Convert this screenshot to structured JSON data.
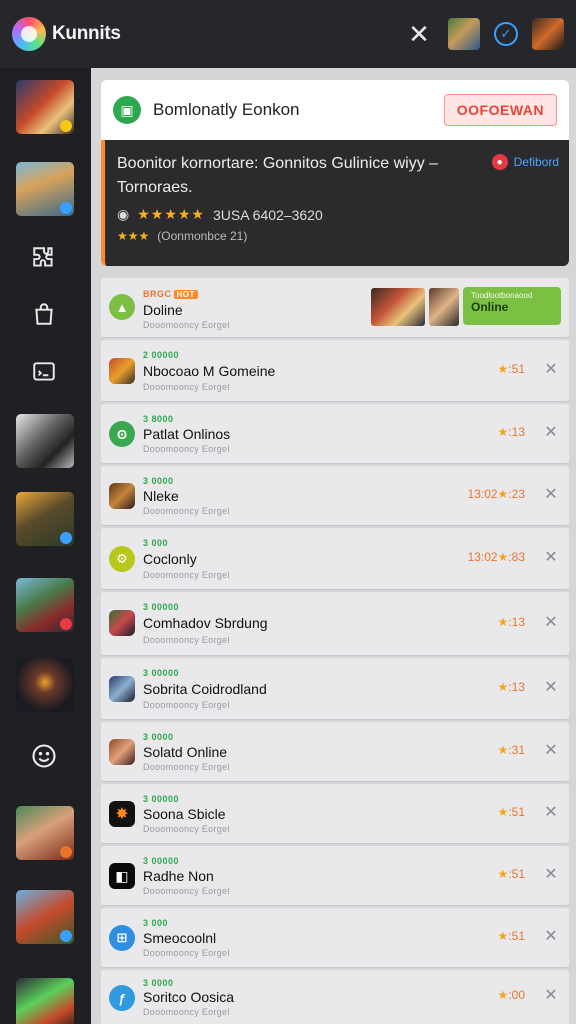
{
  "app": {
    "title": "Kunnits"
  },
  "banner": {
    "title": "Bomlonatly Eonkon",
    "button": "OOFOEWAN"
  },
  "promo": {
    "title": "Boonitor kornortare: Gonnitos Gulinice wiyy – Tornoraes.",
    "tag": "Defibord",
    "rating_stars": "★★★★★",
    "rating_text": "3USA 6402–3620",
    "meta_stars": "★★★",
    "meta_text": "(Oonmonbce 21)"
  },
  "rows": [
    {
      "kicker": "BRGC",
      "hot": "HOT",
      "name": "Doline",
      "sub": "Dooomooncy  Eorgel",
      "chip_small": "Toodlootbonaood",
      "chip_big": "Online"
    },
    {
      "kicker": "2 00000",
      "name": "Nbocoao M Gomeine",
      "sub": "Dooomooncy  Eorgel",
      "rating": "★:51"
    },
    {
      "kicker": "3 8000",
      "name": "Patlat Onlinos",
      "sub": "Dooomooncy  Eorgel",
      "rating": "★:13"
    },
    {
      "kicker": "3 0000",
      "name": "Nleke",
      "sub": "Dooomooncy  Eorgel",
      "rating": "13:02★:23"
    },
    {
      "kicker": "3 000",
      "name": "Coclonly",
      "sub": "Dooomooncy  Eorgel",
      "rating": "13:02★:83"
    },
    {
      "kicker": "3 00000",
      "name": "Comhadov Sbrdung",
      "sub": "Dooomooncy  Eorgel",
      "rating": "★:13"
    },
    {
      "kicker": "3 00000",
      "name": "Sobrita Coidrodland",
      "sub": "Dooomooncy  Eorgel",
      "rating": "★:13"
    },
    {
      "kicker": "3 0000",
      "name": "Solatd Online",
      "sub": "Dooomooncy  Eorgel",
      "rating": "★:31"
    },
    {
      "kicker": "3 00000",
      "name": "Soona Sbicle",
      "sub": "Dooomooncy  Eorgel",
      "rating": "★:51"
    },
    {
      "kicker": "3 00000",
      "name": "Radhe Non",
      "sub": "Dooomooncy  Eorgel",
      "rating": "★:51"
    },
    {
      "kicker": "3 000",
      "name": "Smeocoolnl",
      "sub": "Dooomooncy  Eorgel",
      "rating": "★:51"
    },
    {
      "kicker": "3 0000",
      "name": "Soritco Oosica",
      "sub": "Dooomooncy  Eorgel",
      "rating": "★:00"
    }
  ],
  "colors": {
    "accent_green": "#2ea84f",
    "accent_orange": "#ff8a2a",
    "accent_red": "#e8453a",
    "online_green": "#7bc043"
  },
  "icons": [
    "app-logo-icon",
    "close-icon",
    "check-circle-icon",
    "puzzle-icon",
    "bag-icon",
    "chat-icon",
    "smiley-icon",
    "rating-star-icon"
  ]
}
